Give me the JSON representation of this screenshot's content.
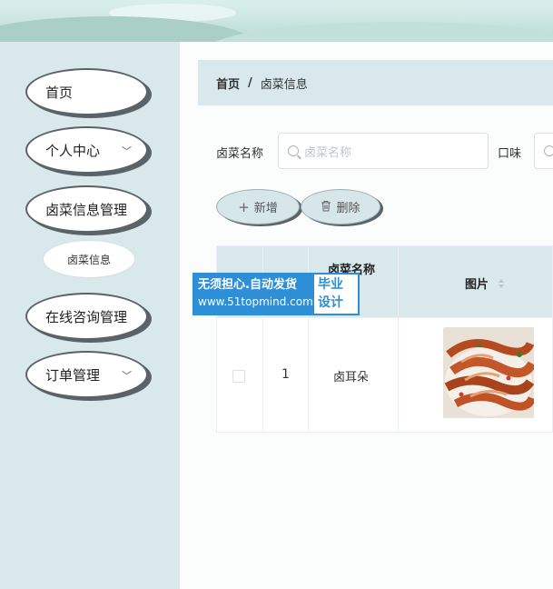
{
  "sidebar": {
    "items": [
      {
        "label": "首页"
      },
      {
        "label": "个人中心"
      },
      {
        "label": "卤菜信息管理"
      },
      {
        "label": "在线咨询管理"
      },
      {
        "label": "订单管理"
      }
    ],
    "submenu": {
      "label": "卤菜信息"
    }
  },
  "breadcrumb": {
    "home": "首页",
    "separator": "/",
    "current": "卤菜信息"
  },
  "search": {
    "name_label": "卤菜名称",
    "name_placeholder": "卤菜名称",
    "taste_label": "口味"
  },
  "actions": {
    "add_label": "新增",
    "delete_label": "删除"
  },
  "table": {
    "headers": {
      "name": "卤菜名称",
      "image": "图片"
    },
    "rows": [
      {
        "index": "1",
        "name": "卤耳朵"
      }
    ]
  },
  "watermark": {
    "line1": "无须担心.自动发货",
    "line2": "www.51topmind.com",
    "badge_line1": "毕业",
    "badge_line2": "设计"
  },
  "colors": {
    "sidebar_bg": "#d9e8eb",
    "header_bg": "#d9e8eb",
    "menu_border": "#5a6369",
    "watermark_blue": "#2f8fd6"
  }
}
